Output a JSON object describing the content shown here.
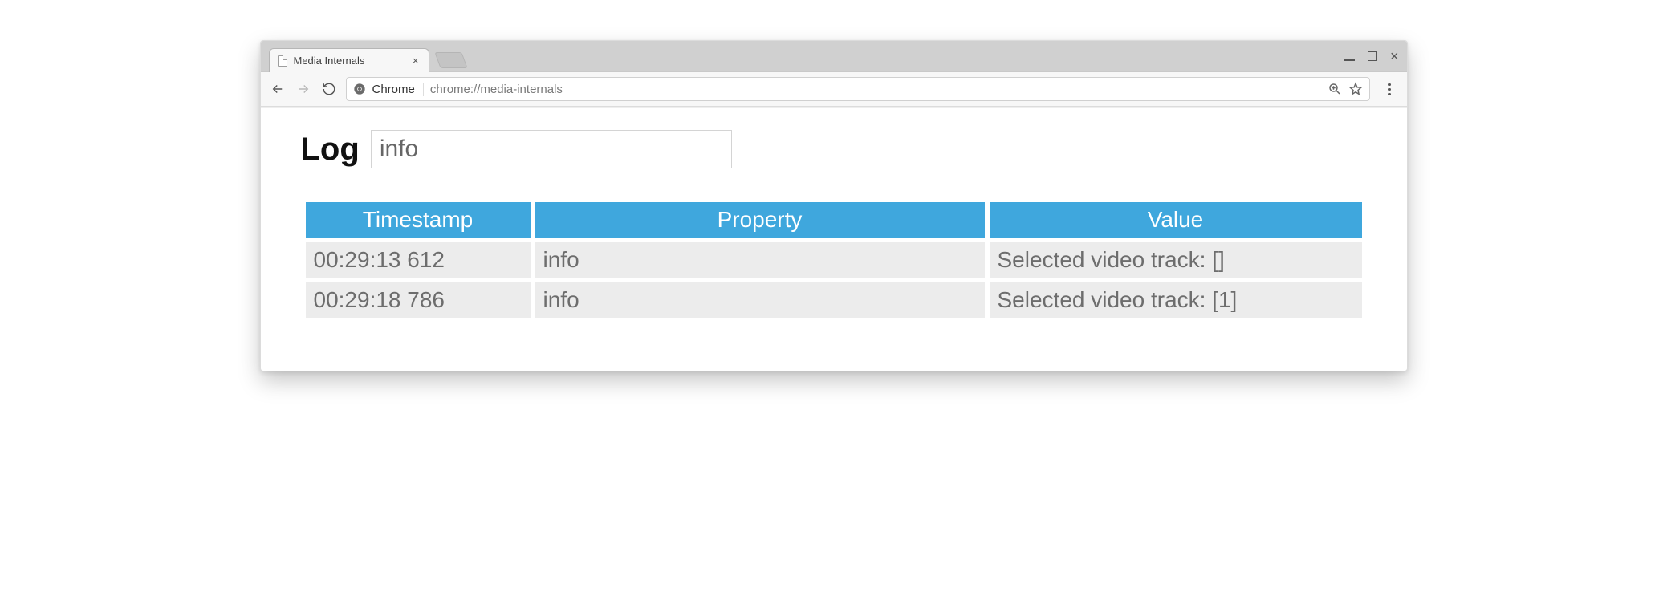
{
  "browser": {
    "tab_title": "Media Internals",
    "scheme_label": "Chrome",
    "url_path": "chrome://media-internals"
  },
  "page": {
    "heading": "Log",
    "filter_value": "info"
  },
  "table": {
    "headers": {
      "timestamp": "Timestamp",
      "property": "Property",
      "value": "Value"
    },
    "rows": [
      {
        "timestamp": "00:29:13 612",
        "property": "info",
        "value": "Selected video track: []"
      },
      {
        "timestamp": "00:29:18 786",
        "property": "info",
        "value": "Selected video track: [1]"
      }
    ]
  }
}
